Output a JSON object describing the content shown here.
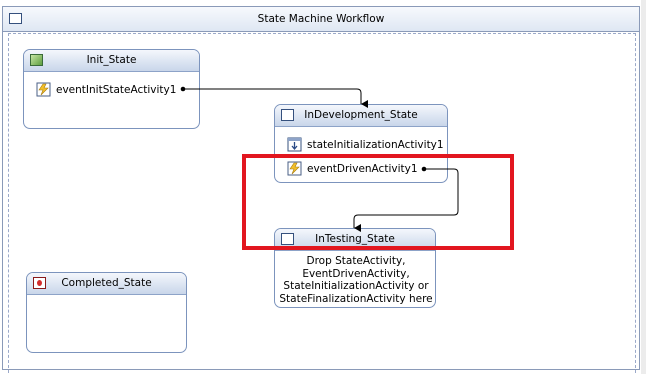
{
  "workflow": {
    "title": "State Machine Workflow"
  },
  "states": {
    "init": {
      "title": "Init_State",
      "icon": "initial-state-icon",
      "activities": [
        "eventInitStateActivity1"
      ]
    },
    "indev": {
      "title": "InDevelopment_State",
      "icon": "state-icon",
      "activities": [
        "stateInitializationActivity1",
        "eventDrivenActivity1"
      ]
    },
    "intesting": {
      "title": "InTesting_State",
      "icon": "state-icon",
      "hint_lines": [
        "Drop StateActivity,",
        "EventDrivenActivity,",
        "StateInitializationActivity or",
        "StateFinalizationActivity here"
      ]
    },
    "completed": {
      "title": "Completed_State",
      "icon": "completed-state-icon"
    }
  },
  "colors": {
    "highlight": "#e2161f",
    "border": "#7c94bd",
    "header_bottom": "#c9d6ea"
  }
}
